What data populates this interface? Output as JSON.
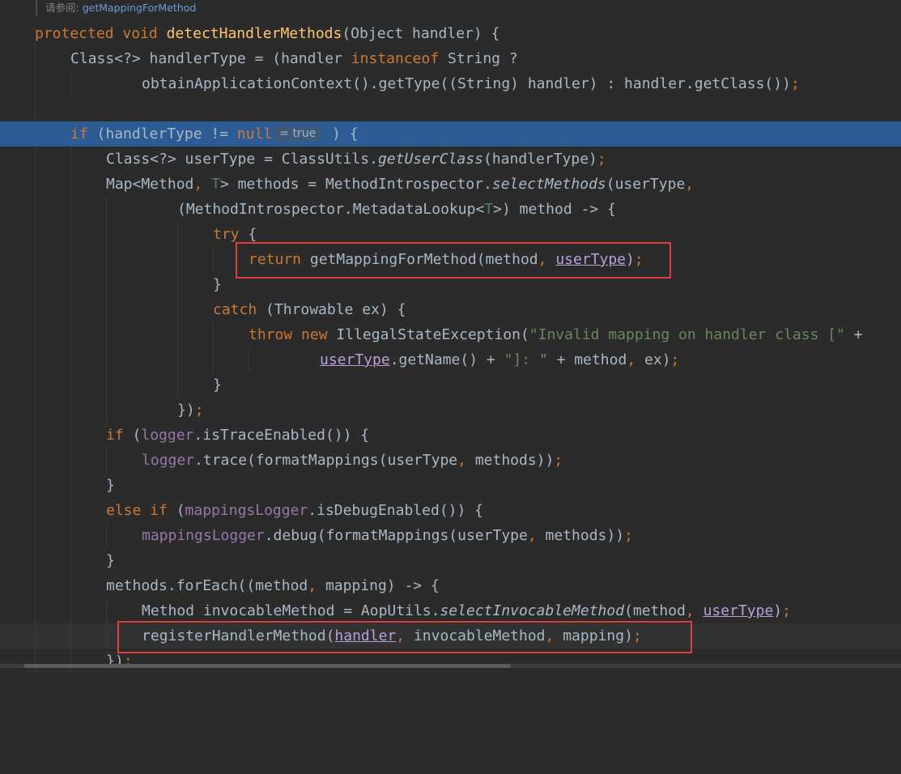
{
  "doc_hint": {
    "label": "请参阅:",
    "link": "getMappingForMethod"
  },
  "debug_hint": "= true",
  "lines": {
    "l1": {
      "kw1": "protected",
      "kw2": "void",
      "name": "detectHandlerMethods",
      "rest": "(Object handler) {"
    },
    "l2": {
      "a": "Class<?> handlerType = (handler ",
      "kw": "instanceof",
      "b": " String ?"
    },
    "l3": {
      "a": "obtainApplicationContext().getType((String) handler) : handler.getClass())",
      "semi": ";"
    },
    "l5": {
      "kw": "if",
      "a": " (handlerType != ",
      "null": "null",
      "b": " ) {"
    },
    "l6": {
      "a": "Class<?> userType = ClassUtils.",
      "m": "getUserClass",
      "b": "(handlerType)",
      "semi": ";"
    },
    "l7": {
      "a": "Map<Method",
      "c": ", ",
      "t": "T",
      "b": "> methods = MethodIntrospector.",
      "m": "selectMethods",
      "d": "(userType",
      "c2": ","
    },
    "l8": {
      "a": "(MethodIntrospector.MetadataLookup<",
      "t": "T",
      "b": ">) method -> {"
    },
    "l9": {
      "kw": "try",
      "b": " {"
    },
    "l10": {
      "kw": "return",
      "a": " getMappingForMethod(method",
      "c": ", ",
      "u": "userType",
      "b": ")",
      "semi": ";"
    },
    "l11": {
      "a": "}"
    },
    "l12": {
      "kw": "catch",
      "a": " (Throwable ex) {"
    },
    "l13": {
      "kw1": "throw",
      "kw2": "new",
      "a": " IllegalStateException(",
      "s": "\"Invalid mapping on handler class [\"",
      "b": " +"
    },
    "l14": {
      "u": "userType",
      "a": ".getName() + ",
      "s": "\"]: \"",
      "b": " + method",
      "c": ", ",
      "d": "ex)",
      "semi": ";"
    },
    "l15": {
      "a": "}"
    },
    "l16": {
      "a": "})",
      "semi": ";"
    },
    "l17": {
      "kw": "if",
      "a": " (",
      "f": "logger",
      "b": ".isTraceEnabled()) {"
    },
    "l18": {
      "f": "logger",
      "a": ".trace(formatMappings(userType",
      "c": ", ",
      "b": "methods))",
      "semi": ";"
    },
    "l19": {
      "a": "}"
    },
    "l20": {
      "kw": "else if",
      "a": " (",
      "f": "mappingsLogger",
      "b": ".isDebugEnabled()) {"
    },
    "l21": {
      "f": "mappingsLogger",
      "a": ".debug(formatMappings(userType",
      "c": ", ",
      "b": "methods))",
      "semi": ";"
    },
    "l22": {
      "a": "}"
    },
    "l23": {
      "a": "methods.forEach((method",
      "c": ", ",
      "b": "mapping) -> {"
    },
    "l24": {
      "a": "Method invocableMethod = AopUtils.",
      "m": "selectInvocableMethod",
      "b": "(method",
      "c": ", ",
      "u": "userType",
      "d": ")",
      "semi": ";"
    },
    "l25": {
      "a": "registerHandlerMethod(",
      "u": "handler",
      "c": ", ",
      "b": "invocableMethod",
      "c2": ", ",
      "d": "mapping)",
      "semi": ";"
    },
    "l26": {
      "a": "})",
      "semi": ";"
    }
  }
}
